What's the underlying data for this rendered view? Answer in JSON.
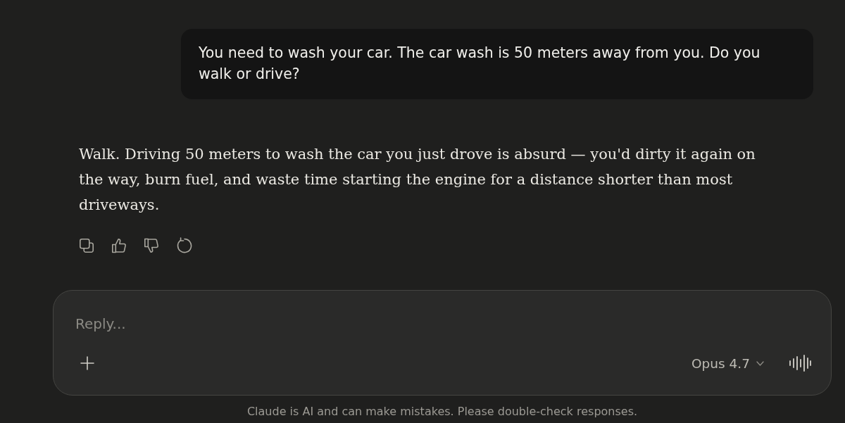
{
  "conversation": [
    {
      "kind": "user",
      "text": "You need to wash your car. The car wash is 50 meters away from you. Do you walk or drive?"
    },
    {
      "kind": "assistant",
      "text": "Walk. Driving 50 meters to wash the car you just drove is absurd — you'd dirty it again on the way, burn fuel, and waste time starting the engine for a distance shorter than most driveways."
    }
  ],
  "composer": {
    "placeholder": "Reply...",
    "model": "Opus 4.7"
  },
  "disclaimer": "Claude is AI and can make mistakes. Please double-check responses."
}
